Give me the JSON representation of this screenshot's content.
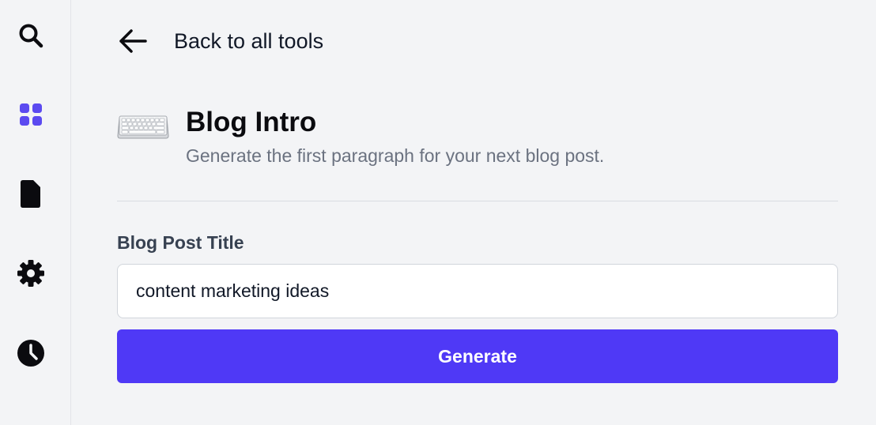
{
  "sidebar": {
    "items": [
      {
        "icon": "search-icon",
        "active": false
      },
      {
        "icon": "grid-icon",
        "active": true
      },
      {
        "icon": "document-icon",
        "active": false
      },
      {
        "icon": "gear-icon",
        "active": false
      },
      {
        "icon": "clock-icon",
        "active": false
      }
    ]
  },
  "header": {
    "back_label": "Back to all tools",
    "back_icon": "arrow-left-icon"
  },
  "tool": {
    "icon": "keyboard-icon",
    "title": "Blog Intro",
    "description": "Generate the first paragraph for your next blog post."
  },
  "form": {
    "title_label": "Blog Post Title",
    "title_value": "content marketing ideas",
    "generate_label": "Generate"
  },
  "colors": {
    "accent": "#4f39f6",
    "active_icon": "#5b4af0",
    "background": "#f3f4f6",
    "muted_text": "#6b7280"
  }
}
